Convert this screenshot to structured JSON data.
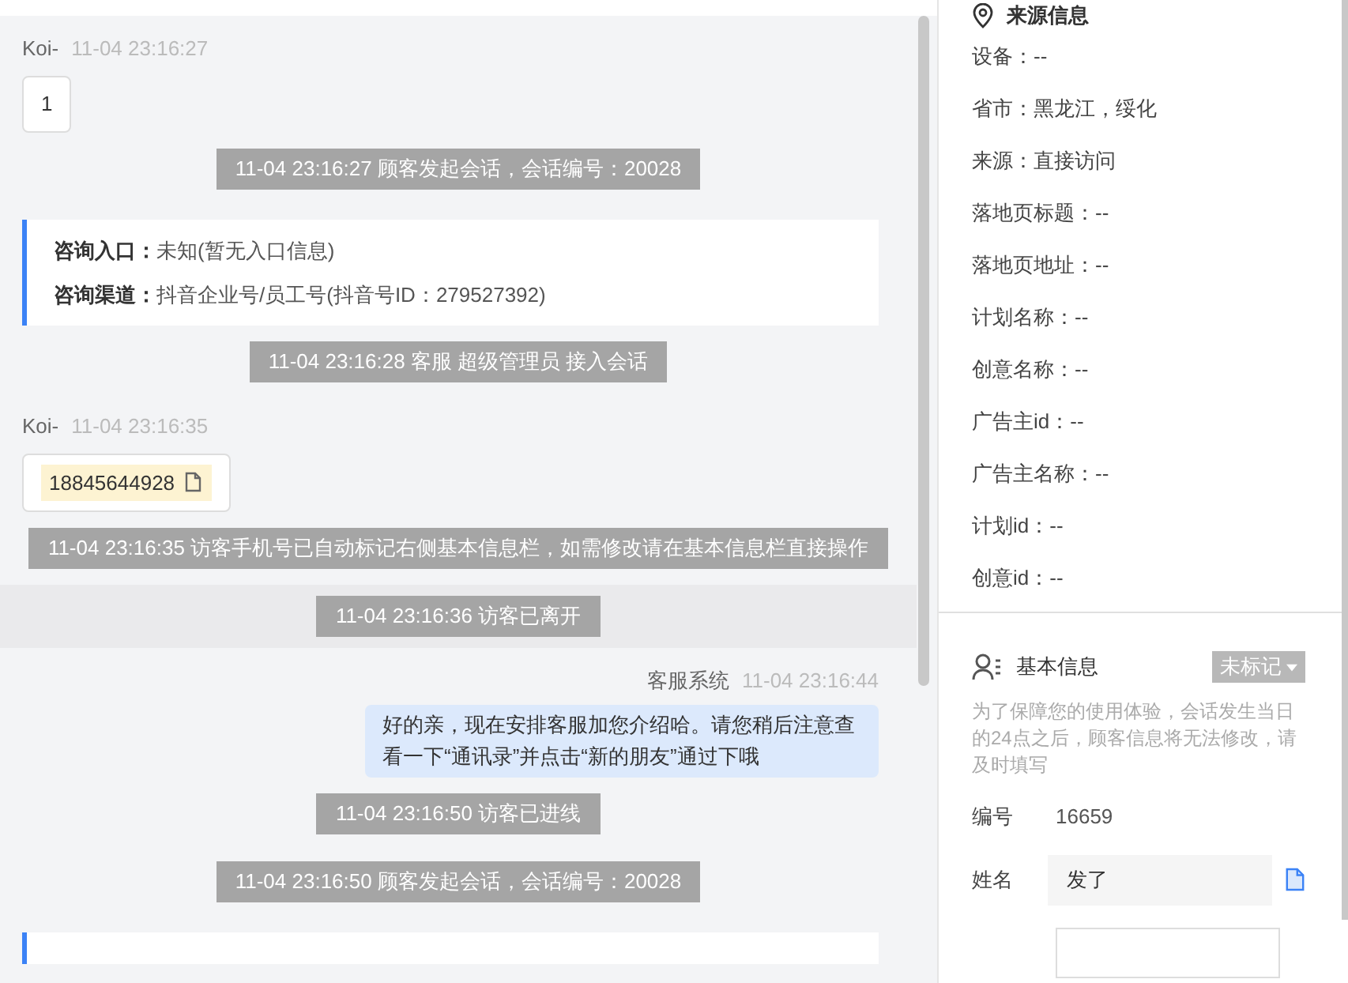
{
  "chat": {
    "messages": [
      {
        "kind": "visitor",
        "sender": "Koi-",
        "time": "11-04 23:16:27",
        "text": "1"
      },
      {
        "kind": "system",
        "text": "11-04 23:16:27 顾客发起会话，会话编号：20028"
      },
      {
        "kind": "info",
        "rows": [
          {
            "label": "咨询入口：",
            "value": "未知(暂无入口信息)"
          },
          {
            "label": "咨询渠道：",
            "value": "抖音企业号/员工号(抖音号ID：279527392)"
          }
        ]
      },
      {
        "kind": "system",
        "text": "11-04 23:16:28 客服 超级管理员 接入会话"
      },
      {
        "kind": "phone",
        "sender": "Koi-",
        "time": "11-04 23:16:35",
        "text": "18845644928"
      },
      {
        "kind": "system",
        "text": "11-04 23:16:35 访客手机号已自动标记右侧基本信息栏，如需修改请在基本信息栏直接操作"
      },
      {
        "kind": "system_band",
        "text": "11-04 23:16:36 访客已离开"
      },
      {
        "kind": "agent",
        "sender": "客服系统",
        "time": "11-04 23:16:44",
        "text": "好的亲，现在安排客服加您介绍哈。请您稍后注意查看一下“通讯录”并点击“新的朋友”通过下哦"
      },
      {
        "kind": "system",
        "text": "11-04 23:16:50 访客已进线"
      },
      {
        "kind": "system",
        "text": "11-04 23:16:50 顾客发起会话，会话编号：20028"
      },
      {
        "kind": "info"
      }
    ]
  },
  "source_info": {
    "title": "来源信息",
    "rows": [
      "设备：--",
      "省市：黑龙江，绥化",
      "来源：直接访问",
      "落地页标题：--",
      "落地页地址：--",
      "计划名称：--",
      "创意名称：--",
      "广告主id：--",
      "广告主名称：--",
      "计划id：--",
      "创意id：--"
    ]
  },
  "basic_info": {
    "title": "基本信息",
    "tag": "未标记",
    "note": "为了保障您的使用体验，会话发生当日的24点之后，顾客信息将无法修改，请及时填写",
    "fields": [
      {
        "kind": "text",
        "label": "编号",
        "value": "16659"
      },
      {
        "kind": "input",
        "label": "姓名",
        "value": "发了",
        "copyable": true
      },
      {
        "kind": "input"
      }
    ]
  }
}
